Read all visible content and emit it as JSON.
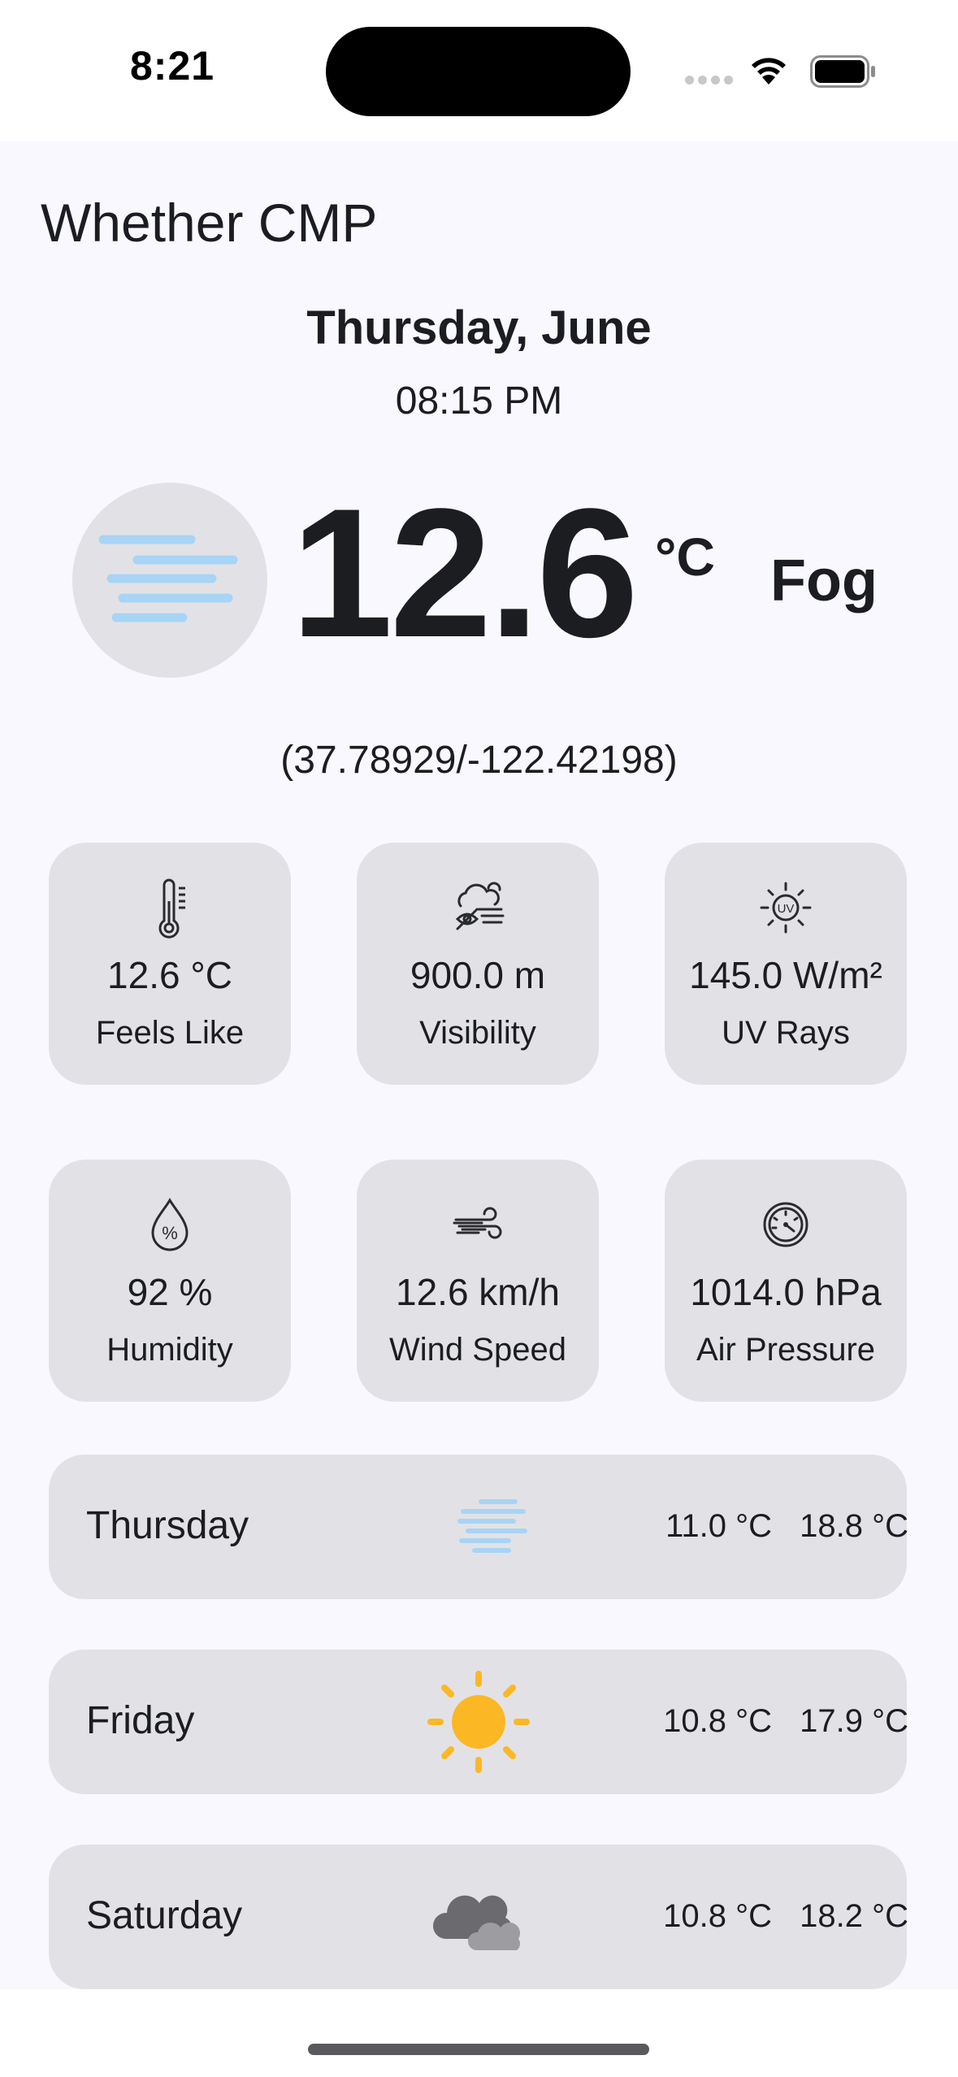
{
  "status_bar": {
    "time": "8:21"
  },
  "app": {
    "title": "Whether CMP"
  },
  "current": {
    "date": "Thursday, June",
    "time": "08:15 PM",
    "temperature": "12.6",
    "unit": "°C",
    "condition": "Fog",
    "coordinates": "(37.78929/-122.42198)",
    "icon": "fog-icon"
  },
  "stats": [
    {
      "value": "12.6 °C",
      "label": "Feels Like",
      "icon": "thermometer-icon"
    },
    {
      "value": "900.0 m",
      "label": "Visibility",
      "icon": "visibility-icon"
    },
    {
      "value": "145.0 W/m²",
      "label": "UV Rays",
      "icon": "uv-icon"
    },
    {
      "value": "92 %",
      "label": "Humidity",
      "icon": "humidity-icon"
    },
    {
      "value": "12.6 km/h",
      "label": "Wind Speed",
      "icon": "wind-icon"
    },
    {
      "value": "1014.0 hPa",
      "label": "Air Pressure",
      "icon": "pressure-gauge-icon"
    }
  ],
  "forecast": [
    {
      "day": "Thursday",
      "min": "11.0 °C",
      "max": "18.8 °C",
      "icon": "fog-icon"
    },
    {
      "day": "Friday",
      "min": "10.8 °C",
      "max": "17.9 °C",
      "icon": "sun-icon"
    },
    {
      "day": "Saturday",
      "min": "10.8 °C",
      "max": "18.2 °C",
      "icon": "cloud-icon"
    }
  ],
  "colors": {
    "background": "#f8f8fe",
    "card": "#e2e2e6",
    "fog_blue": "#a8d4f5",
    "sun_yellow": "#fbb824",
    "cloud_gray": "#6b6b6f"
  }
}
